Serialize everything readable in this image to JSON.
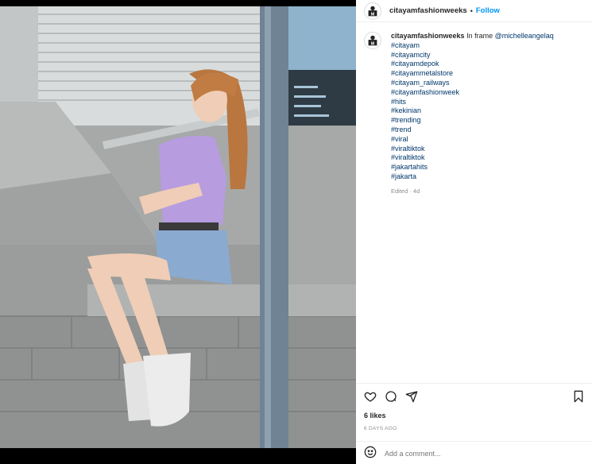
{
  "post": {
    "username": "citayamfashionweeks",
    "follow_label": "Follow",
    "separator": "•",
    "caption_text": "In frame",
    "caption_mention": "@michelleangelaq",
    "hashtags": [
      "#citayam",
      "#citayamcity",
      "#citayamdepok",
      "#citayammetalstore",
      "#citayam_railways",
      "#citayamfashionweek",
      "#hits",
      "#kekinian",
      "#trending",
      "#trend",
      "#viral",
      "#viraltiktok",
      "#viraltiktok",
      "#jakartahits",
      "#jakarta"
    ],
    "edited": "Edited · 4d",
    "likes": "6 likes",
    "date": "6 DAYS AGO",
    "comment_placeholder": "Add a comment..."
  },
  "icons": {
    "like": "heart-icon",
    "comment": "comment-icon",
    "share": "share-icon",
    "save": "bookmark-icon",
    "emoji": "emoji-icon"
  },
  "colors": {
    "link": "#0095f6",
    "hashtag": "#00376b",
    "muted": "#8e8e8e"
  }
}
